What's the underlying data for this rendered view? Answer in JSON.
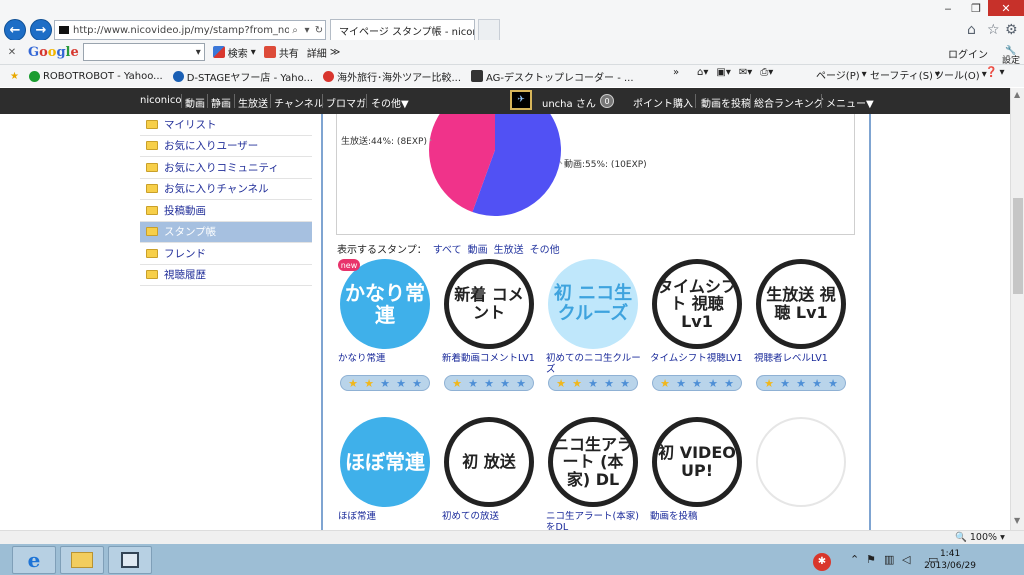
{
  "browser": {
    "url": "http://www.nicovideo.jp/my/stamp?from_noti",
    "tab_title": "マイページ スタンプ帳 - nicon...",
    "win_min": "‒",
    "win_restore": "❐",
    "win_close": "✕",
    "close_tab": "×"
  },
  "google_bar": {
    "logo": "Google",
    "search_label": "検索",
    "share_label": "共有",
    "more_label": "詳細",
    "more_chevrons": "≫",
    "login_label": "ログイン",
    "settings_label": "設定"
  },
  "favorites": {
    "items": [
      {
        "label": "ROBOTROBOT - Yahoo...",
        "color": "#1a9c2f"
      },
      {
        "label": "D-STAGEヤフー店 - Yaho...",
        "color": "#1a5fb4"
      },
      {
        "label": "海外旅行･海外ツアー比較...",
        "color": "#d8352e"
      },
      {
        "label": "AG-デスクトップレコーダー - ...",
        "color": "#333333"
      }
    ],
    "chevrons": "»",
    "commands": {
      "page": "ページ(P)",
      "safety": "セーフティ(S)",
      "tools": "ツール(O)"
    }
  },
  "nico_header": {
    "left_items": [
      "niconico",
      "動画",
      "静画",
      "生放送",
      "チャンネル",
      "ブロマガ",
      "その他▼"
    ],
    "user": "uncha さん",
    "points_count": "0",
    "buy_points": "ポイント購入",
    "post_video": "動画を投稿",
    "ranking": "総合ランキング",
    "menu": "メニュー▼"
  },
  "sidebar": {
    "items": [
      {
        "label": "マイリスト",
        "active": false
      },
      {
        "label": "お気に入りユーザー",
        "active": false
      },
      {
        "label": "お気に入りコミュニティ",
        "active": false
      },
      {
        "label": "お気に入りチャンネル",
        "active": false
      },
      {
        "label": "投稿動画",
        "active": false
      },
      {
        "label": "スタンプ帳",
        "active": true
      },
      {
        "label": "フレンド",
        "active": false
      },
      {
        "label": "視聴履歴",
        "active": false
      }
    ]
  },
  "chart_data": {
    "type": "pie",
    "slices": [
      {
        "label": "生放送:44%: (8EXP)",
        "value": 44,
        "color": "#f0338a"
      },
      {
        "label": "動画:55%: (10EXP)",
        "value": 55,
        "color": "#5151f4"
      }
    ]
  },
  "filter": {
    "label": "表示するスタンプ：",
    "options": [
      "すべて",
      "動画",
      "生放送",
      "その他"
    ]
  },
  "stamps": [
    {
      "name": "かなり常連",
      "art": "かなり常連",
      "style": "st-blue",
      "stars": 2,
      "new_label": "new"
    },
    {
      "name": "新着動画コメントLV1",
      "art": "新着 コメント",
      "style": "st-dark",
      "stars": 1
    },
    {
      "name": "初めてのニコ生クルーズ",
      "art": "初 ニコ生クルーズ",
      "style": "st-light",
      "stars": 2
    },
    {
      "name": "タイムシフト視聴LV1",
      "art": "タイムシフト 視聴 Lv1",
      "style": "st-dark",
      "stars": 1
    },
    {
      "name": "視聴者レベルLV1",
      "art": "生放送 視聴 Lv1",
      "style": "st-dark",
      "stars": 1
    },
    {
      "name": "ほぼ常連",
      "art": "ほぼ常連",
      "style": "st-blue"
    },
    {
      "name": "初めての放送",
      "art": "初 放送",
      "style": "st-dark"
    },
    {
      "name": "ニコ生アラート(本家)をDL",
      "art": "ニコ生アラート (本家) DL",
      "style": "st-dark"
    },
    {
      "name": "動画を投稿",
      "art": "初 VIDEO UP!",
      "style": "st-dark"
    },
    {
      "name": "",
      "art": "",
      "style": "st-empty"
    }
  ],
  "status_bar": {
    "zoom": "100%"
  },
  "taskbar": {
    "time": "1:41",
    "date": "2013/06/29"
  },
  "colors": {
    "nico_bar": "#2d2d2d",
    "frame_blue": "#7fa4d1",
    "link_blue": "#23309a",
    "star_gold": "#f1b71b",
    "star_blue": "#4e8fd6"
  }
}
